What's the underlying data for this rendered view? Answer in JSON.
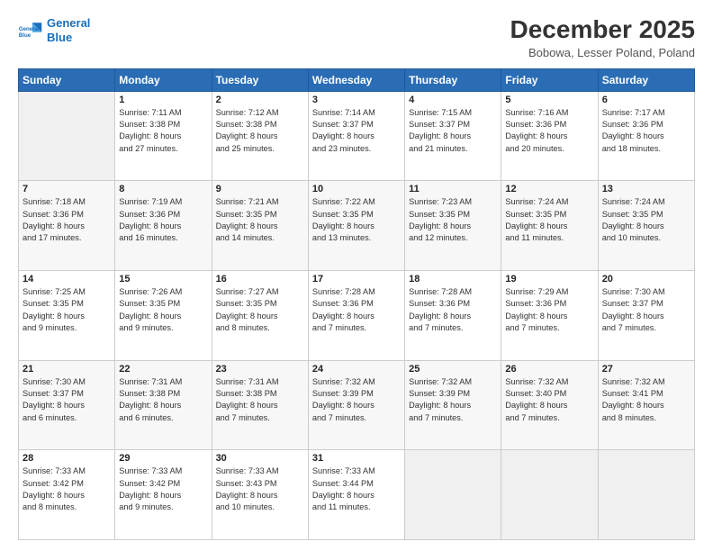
{
  "header": {
    "logo_line1": "General",
    "logo_line2": "Blue",
    "month": "December 2025",
    "location": "Bobowa, Lesser Poland, Poland"
  },
  "weekdays": [
    "Sunday",
    "Monday",
    "Tuesday",
    "Wednesday",
    "Thursday",
    "Friday",
    "Saturday"
  ],
  "weeks": [
    [
      {
        "day": "",
        "info": ""
      },
      {
        "day": "1",
        "info": "Sunrise: 7:11 AM\nSunset: 3:38 PM\nDaylight: 8 hours\nand 27 minutes."
      },
      {
        "day": "2",
        "info": "Sunrise: 7:12 AM\nSunset: 3:38 PM\nDaylight: 8 hours\nand 25 minutes."
      },
      {
        "day": "3",
        "info": "Sunrise: 7:14 AM\nSunset: 3:37 PM\nDaylight: 8 hours\nand 23 minutes."
      },
      {
        "day": "4",
        "info": "Sunrise: 7:15 AM\nSunset: 3:37 PM\nDaylight: 8 hours\nand 21 minutes."
      },
      {
        "day": "5",
        "info": "Sunrise: 7:16 AM\nSunset: 3:36 PM\nDaylight: 8 hours\nand 20 minutes."
      },
      {
        "day": "6",
        "info": "Sunrise: 7:17 AM\nSunset: 3:36 PM\nDaylight: 8 hours\nand 18 minutes."
      }
    ],
    [
      {
        "day": "7",
        "info": "Sunrise: 7:18 AM\nSunset: 3:36 PM\nDaylight: 8 hours\nand 17 minutes."
      },
      {
        "day": "8",
        "info": "Sunrise: 7:19 AM\nSunset: 3:36 PM\nDaylight: 8 hours\nand 16 minutes."
      },
      {
        "day": "9",
        "info": "Sunrise: 7:21 AM\nSunset: 3:35 PM\nDaylight: 8 hours\nand 14 minutes."
      },
      {
        "day": "10",
        "info": "Sunrise: 7:22 AM\nSunset: 3:35 PM\nDaylight: 8 hours\nand 13 minutes."
      },
      {
        "day": "11",
        "info": "Sunrise: 7:23 AM\nSunset: 3:35 PM\nDaylight: 8 hours\nand 12 minutes."
      },
      {
        "day": "12",
        "info": "Sunrise: 7:24 AM\nSunset: 3:35 PM\nDaylight: 8 hours\nand 11 minutes."
      },
      {
        "day": "13",
        "info": "Sunrise: 7:24 AM\nSunset: 3:35 PM\nDaylight: 8 hours\nand 10 minutes."
      }
    ],
    [
      {
        "day": "14",
        "info": "Sunrise: 7:25 AM\nSunset: 3:35 PM\nDaylight: 8 hours\nand 9 minutes."
      },
      {
        "day": "15",
        "info": "Sunrise: 7:26 AM\nSunset: 3:35 PM\nDaylight: 8 hours\nand 9 minutes."
      },
      {
        "day": "16",
        "info": "Sunrise: 7:27 AM\nSunset: 3:35 PM\nDaylight: 8 hours\nand 8 minutes."
      },
      {
        "day": "17",
        "info": "Sunrise: 7:28 AM\nSunset: 3:36 PM\nDaylight: 8 hours\nand 7 minutes."
      },
      {
        "day": "18",
        "info": "Sunrise: 7:28 AM\nSunset: 3:36 PM\nDaylight: 8 hours\nand 7 minutes."
      },
      {
        "day": "19",
        "info": "Sunrise: 7:29 AM\nSunset: 3:36 PM\nDaylight: 8 hours\nand 7 minutes."
      },
      {
        "day": "20",
        "info": "Sunrise: 7:30 AM\nSunset: 3:37 PM\nDaylight: 8 hours\nand 7 minutes."
      }
    ],
    [
      {
        "day": "21",
        "info": "Sunrise: 7:30 AM\nSunset: 3:37 PM\nDaylight: 8 hours\nand 6 minutes."
      },
      {
        "day": "22",
        "info": "Sunrise: 7:31 AM\nSunset: 3:38 PM\nDaylight: 8 hours\nand 6 minutes."
      },
      {
        "day": "23",
        "info": "Sunrise: 7:31 AM\nSunset: 3:38 PM\nDaylight: 8 hours\nand 7 minutes."
      },
      {
        "day": "24",
        "info": "Sunrise: 7:32 AM\nSunset: 3:39 PM\nDaylight: 8 hours\nand 7 minutes."
      },
      {
        "day": "25",
        "info": "Sunrise: 7:32 AM\nSunset: 3:39 PM\nDaylight: 8 hours\nand 7 minutes."
      },
      {
        "day": "26",
        "info": "Sunrise: 7:32 AM\nSunset: 3:40 PM\nDaylight: 8 hours\nand 7 minutes."
      },
      {
        "day": "27",
        "info": "Sunrise: 7:32 AM\nSunset: 3:41 PM\nDaylight: 8 hours\nand 8 minutes."
      }
    ],
    [
      {
        "day": "28",
        "info": "Sunrise: 7:33 AM\nSunset: 3:42 PM\nDaylight: 8 hours\nand 8 minutes."
      },
      {
        "day": "29",
        "info": "Sunrise: 7:33 AM\nSunset: 3:42 PM\nDaylight: 8 hours\nand 9 minutes."
      },
      {
        "day": "30",
        "info": "Sunrise: 7:33 AM\nSunset: 3:43 PM\nDaylight: 8 hours\nand 10 minutes."
      },
      {
        "day": "31",
        "info": "Sunrise: 7:33 AM\nSunset: 3:44 PM\nDaylight: 8 hours\nand 11 minutes."
      },
      {
        "day": "",
        "info": ""
      },
      {
        "day": "",
        "info": ""
      },
      {
        "day": "",
        "info": ""
      }
    ]
  ]
}
